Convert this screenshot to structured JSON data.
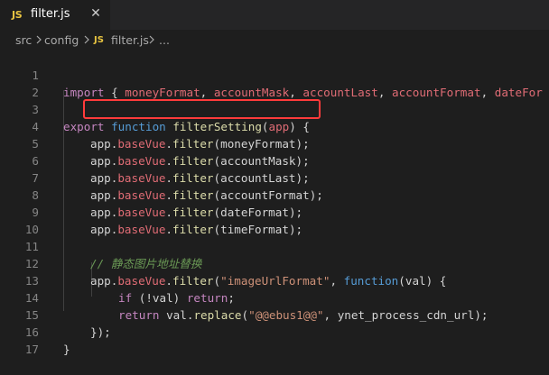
{
  "tab": {
    "icon": "JS",
    "filename": "filter.js",
    "close": "✕"
  },
  "breadcrumb": {
    "items": [
      "src",
      "config",
      "filter.js",
      "..."
    ],
    "file_icon": "JS"
  },
  "code_lines": [
    {
      "n": "1"
    },
    {
      "n": "2"
    },
    {
      "n": "3"
    },
    {
      "n": "4"
    },
    {
      "n": "5"
    },
    {
      "n": "6"
    },
    {
      "n": "7"
    },
    {
      "n": "8"
    },
    {
      "n": "9"
    },
    {
      "n": "10"
    },
    {
      "n": "11"
    },
    {
      "n": "12"
    },
    {
      "n": "13"
    },
    {
      "n": "14"
    },
    {
      "n": "15"
    },
    {
      "n": "16"
    },
    {
      "n": "17"
    }
  ],
  "tokens": {
    "l1_import": "import",
    "l1_open": " { ",
    "l1_i1": "moneyFormat",
    "l1_c1": ", ",
    "l1_i2": "accountMask",
    "l1_c2": ", ",
    "l1_i3": "accountLast",
    "l1_c3": ", ",
    "l1_i4": "accountFormat",
    "l1_c4": ", ",
    "l1_i5": "dateFor",
    "l3_export": "export",
    "l3_function": " function ",
    "l3_name": "filterSetting",
    "l3_p1": "(",
    "l3_param": "app",
    "l3_p2": ") {",
    "app": "app",
    "dot": ".",
    "baseVue": "baseVue",
    "filter": "filter",
    "open": "(",
    "close_semi": ");",
    "l4_arg": "moneyFormat",
    "l5_arg": "accountMask",
    "l6_arg": "accountLast",
    "l7_arg": "accountFormat",
    "l8_arg": "dateFormat",
    "l9_arg": "timeFormat",
    "l11_comment": "// 静态图片地址替换",
    "l12_str": "\"imageUrlFormat\"",
    "l12_comma": ", ",
    "l12_function": "function",
    "l12_p1": "(",
    "l12_param": "val",
    "l12_p2": ") {",
    "l13_if": "if",
    "l13_open": " (!",
    "l13_val": "val",
    "l13_close": ") ",
    "l13_return": "return",
    "l13_semi": ";",
    "l14_return": "return",
    "l14_sp": " ",
    "l14_val": "val",
    "l14_replace": "replace",
    "l14_str": "\"@@ebus1@@\"",
    "l14_comma": ", ",
    "l14_arg2": "ynet_process_cdn_url",
    "l15_close": "});",
    "l16_close": "}"
  },
  "colors": {
    "background": "#1e1e1e",
    "keyword": "#c586c0",
    "function_decl": "#569cd6",
    "function_name": "#dcdcaa",
    "variable": "#9cdcfe",
    "string": "#ce9178",
    "comment": "#6a9955",
    "highlight_border": "#ff3b3b"
  }
}
